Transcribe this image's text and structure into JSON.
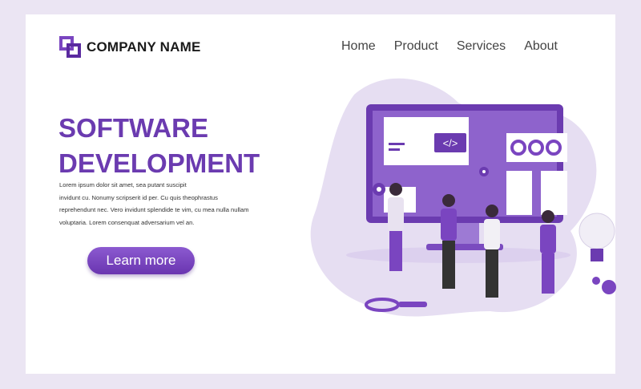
{
  "header": {
    "company_name": "COMPANY NAME",
    "nav": [
      "Home",
      "Product",
      "Services",
      "About"
    ]
  },
  "hero": {
    "title_line1": "SOFTWARE",
    "title_line2": "DEVELOPMENT",
    "body": [
      "Lorem ipsum dolor sit amet, sea putant suscipit",
      "invidunt cu. Nonumy scripserit id per. Cu quis theophrastus",
      "reprehendunt nec. Vero invidunt splendide te vim, cu mea nulla nullam",
      "voluptaria. Lorem consenquat adversarium vel an."
    ],
    "cta_label": "Learn more",
    "code_icon_text": "</>"
  },
  "colors": {
    "accent": "#6b3bb0",
    "background": "#ebe5f3",
    "blob": "#e6def2"
  }
}
